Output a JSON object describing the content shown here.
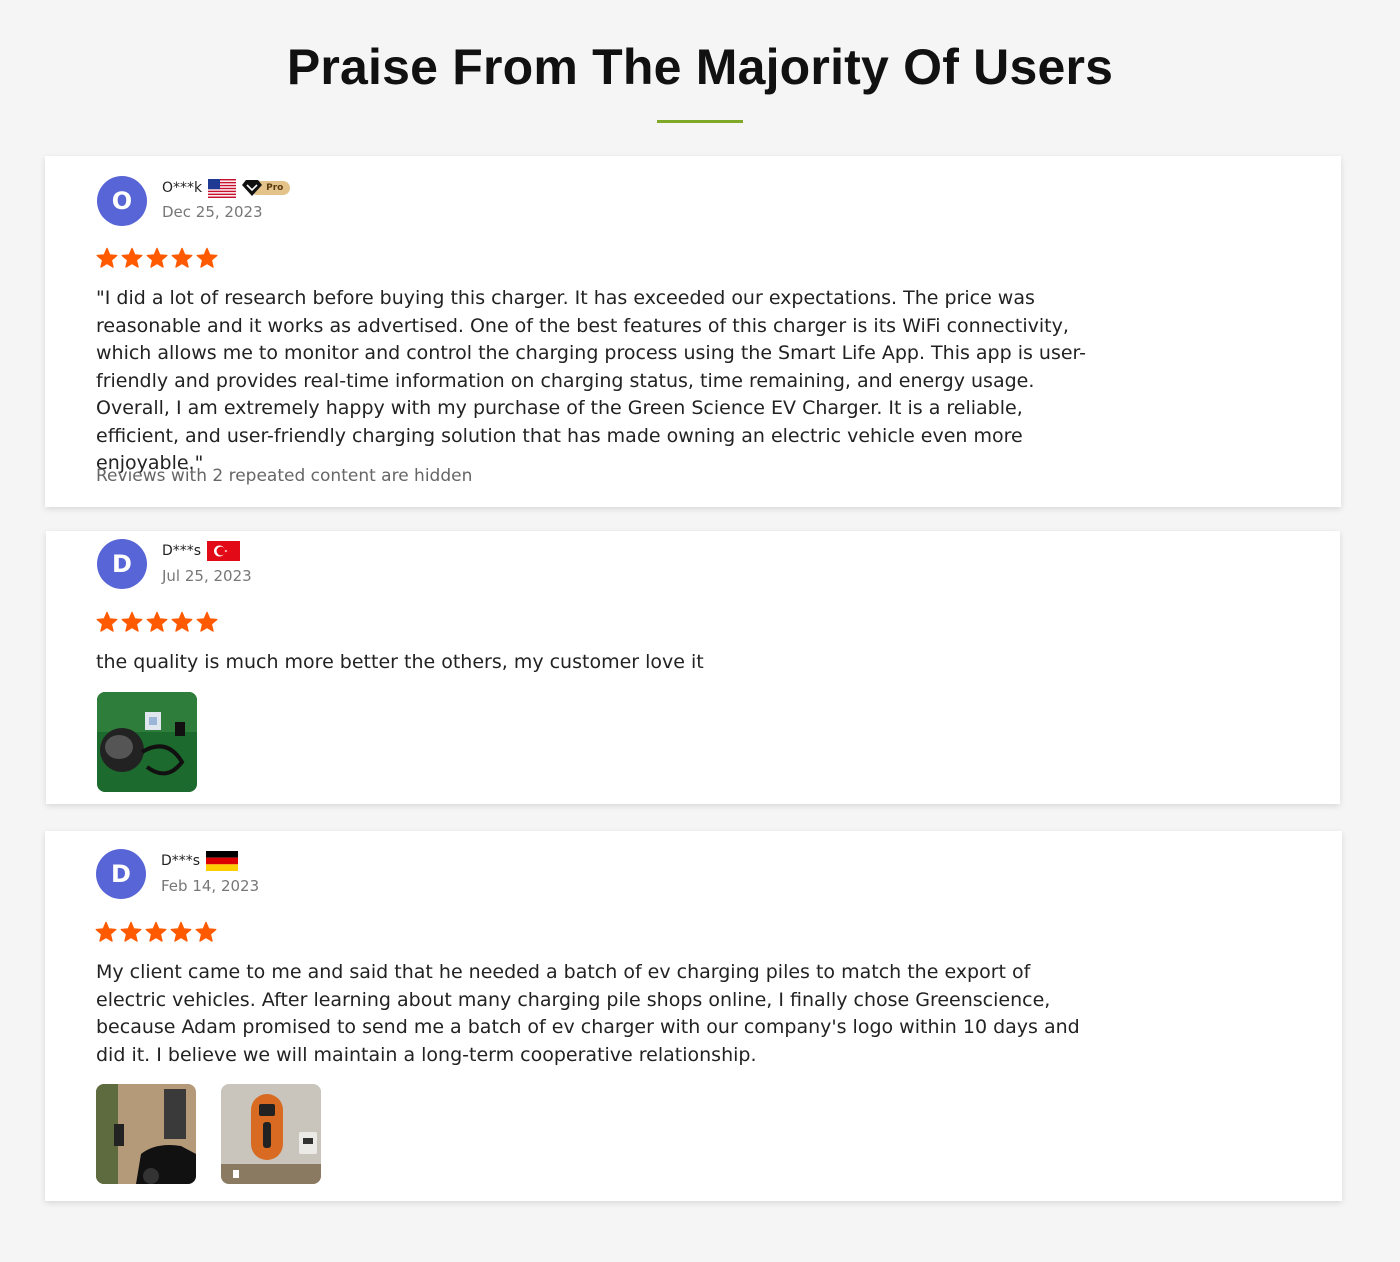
{
  "page": {
    "title": "Praise From The Majority Of Users"
  },
  "colors": {
    "accent_underline": "#7fa828",
    "avatar_bg": "#5865d6",
    "star": "#ff5a00"
  },
  "reviews": [
    {
      "avatar_letter": "O",
      "user": "O***k",
      "flag_icon": "us-flag-icon",
      "badge": "Pro",
      "date": "Dec 25, 2023",
      "rating": 5,
      "text": "\"I did a lot of research before buying this charger. It has exceeded our expectations. The price was reasonable and it works as advertised. One of the best features of this charger is its WiFi connectivity, which allows me to monitor and control the charging process using the Smart Life App. This app is user-friendly and provides real-time information on charging status, time remaining, and energy usage. Overall, I am extremely happy with my purchase of the Green Science EV Charger. It is a reliable, efficient, and user-friendly charging solution that has made owning an electric vehicle even more enjoyable.\"",
      "note": "Reviews with 2 repeated content are hidden"
    },
    {
      "avatar_letter": "D",
      "user": "D***s",
      "flag_icon": "turkey-flag-icon",
      "date": "Jul 25, 2023",
      "rating": 5,
      "text": "the quality is much more better the others, my customer love it"
    },
    {
      "avatar_letter": "D",
      "user": "D***s",
      "flag_icon": "germany-flag-icon",
      "date": "Feb 14, 2023",
      "rating": 5,
      "text": "My client came to me and said that he needed a batch of ev charging piles to match the export of electric vehicles. After learning about many charging pile shops online, I finally chose Greenscience, because Adam promised to send me a batch of ev charger with our company's logo within 10 days and did it. I believe we will maintain a long-term cooperative relationship."
    }
  ]
}
